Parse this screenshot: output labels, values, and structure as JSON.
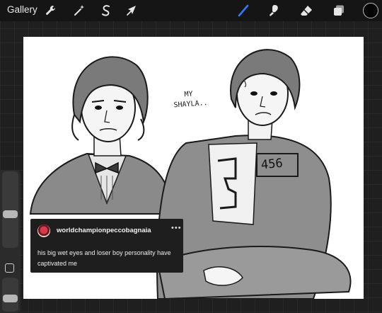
{
  "toolbar": {
    "gallery_label": "Gallery",
    "left_tools": [
      "wrench-icon",
      "magic-wand-icon",
      "selection-s-icon",
      "move-arrow-icon"
    ],
    "right_tools": [
      "brush-icon",
      "smudge-icon",
      "eraser-icon",
      "layers-icon"
    ],
    "active_tool": "brush-icon",
    "active_color": "#050505",
    "brush_accent": "#2f7bf5"
  },
  "sidebar": {
    "brush_size": 0.43,
    "brush_opacity": 0.35
  },
  "canvas": {
    "handwriting_line1": "MY",
    "handwriting_line2": "SHAYLA..",
    "number_tag": "456"
  },
  "post": {
    "username": "worldchampionpeccobagnaia",
    "more_label": "•••",
    "text": "his big wet eyes and loser boy personality have captivated me"
  }
}
